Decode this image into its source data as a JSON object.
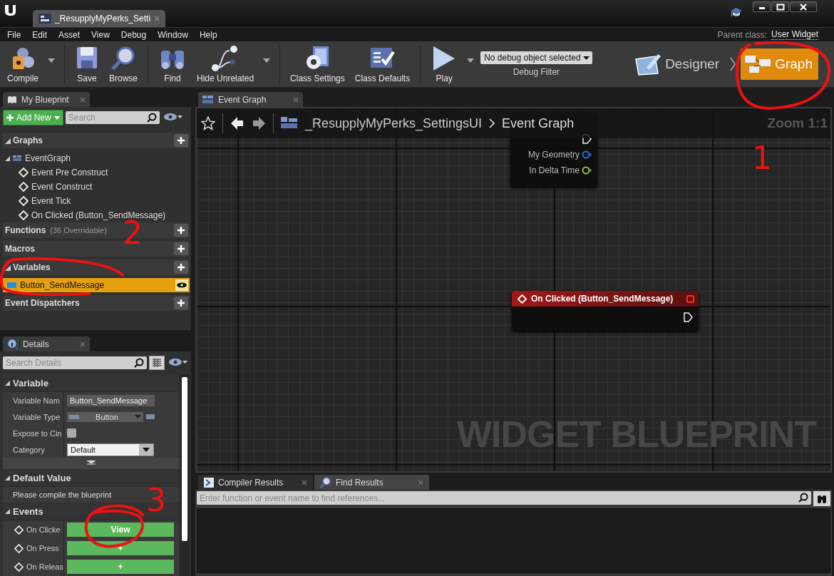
{
  "window": {
    "tab_title": "_ResupplyMyPerks_Setti"
  },
  "menu": [
    "File",
    "Edit",
    "Asset",
    "View",
    "Debug",
    "Window",
    "Help"
  ],
  "parent_class": {
    "label": "Parent class:",
    "value": "User Widget"
  },
  "toolbar": {
    "groups": [
      [
        {
          "kind": "compile",
          "label": "Compile",
          "dropdown": true
        }
      ],
      [
        {
          "kind": "save",
          "label": "Save",
          "dropdown": false
        },
        {
          "kind": "browse",
          "label": "Browse",
          "dropdown": false
        }
      ],
      [
        {
          "kind": "find",
          "label": "Find",
          "dropdown": false
        },
        {
          "kind": "hide",
          "label": "Hide Unrelated",
          "dropdown": true
        }
      ],
      [
        {
          "kind": "settings",
          "label": "Class Settings",
          "dropdown": false
        },
        {
          "kind": "defaults",
          "label": "Class Defaults",
          "dropdown": false
        }
      ],
      [
        {
          "kind": "play",
          "label": "Play",
          "dropdown": true
        }
      ]
    ],
    "debug_filter": {
      "value": "No debug object selected",
      "label": "Debug Filter"
    },
    "modes": [
      {
        "kind": "designer",
        "label": "Designer",
        "selected": false
      },
      {
        "kind": "graph",
        "label": "Graph",
        "selected": true
      }
    ]
  },
  "my_blueprint": {
    "tab": "My Blueprint",
    "add_button": "Add New",
    "search_placeholder": "Search",
    "sections": [
      {
        "title": "Graphs",
        "expanded": true,
        "items": [
          {
            "label": "EventGraph",
            "kind": "graph",
            "selected": false,
            "children": [
              {
                "label": "Event Pre Construct"
              },
              {
                "label": "Event Construct"
              },
              {
                "label": "Event Tick"
              },
              {
                "label": "On Clicked (Button_SendMessage)"
              }
            ]
          }
        ]
      },
      {
        "title": "Functions",
        "note": "(36 Overridable)",
        "expanded": false
      },
      {
        "title": "Macros",
        "expanded": false
      },
      {
        "title": "Variables",
        "expanded": true,
        "items": [
          {
            "label": "Button_SendMessage",
            "kind": "variable",
            "selected": true
          }
        ]
      },
      {
        "title": "Event Dispatchers",
        "expanded": false
      }
    ]
  },
  "details": {
    "tab": "Details",
    "search_placeholder": "Search Details",
    "categories": [
      {
        "title": "Variable",
        "rows": [
          {
            "label": "Variable Nam",
            "kind": "text",
            "value": "Button_SendMessage"
          },
          {
            "label": "Variable Type",
            "kind": "type",
            "value": "Button"
          },
          {
            "label": "Expose to Cin",
            "kind": "checkbox",
            "checked": false
          },
          {
            "label": "Category",
            "kind": "combo",
            "value": "Default"
          }
        ]
      },
      {
        "title": "Default Value",
        "message": "Please compile the blueprint"
      },
      {
        "title": "Events",
        "rows": [
          {
            "label": "On Clicke",
            "kind": "event",
            "button": "View"
          },
          {
            "label": "On Press",
            "kind": "event",
            "button": "+"
          },
          {
            "label": "On Releas",
            "kind": "event",
            "button": "+"
          }
        ]
      }
    ]
  },
  "graph": {
    "tab": "Event Graph",
    "breadcrumb": [
      "_ResupplyMyPerks_SettingsUI",
      "Event Graph"
    ],
    "zoom": "Zoom 1:1",
    "nodes": [
      {
        "pins": [
          {
            "label": "My Geometry",
            "color": "#2a6fd6"
          },
          {
            "label": "In Delta Time",
            "color": "#8cc43c"
          }
        ]
      },
      {
        "title": "On Clicked (Button_SendMessage)"
      }
    ],
    "watermark": "WIDGET BLUEPRINT"
  },
  "results": {
    "tabs": [
      {
        "label": "Compiler Results",
        "selected": false
      },
      {
        "label": "Find Results",
        "selected": true
      }
    ],
    "find_placeholder": "Enter function or event name to find references..."
  },
  "annotations": [
    {
      "label": "1"
    },
    {
      "label": "2"
    },
    {
      "label": "3"
    }
  ]
}
